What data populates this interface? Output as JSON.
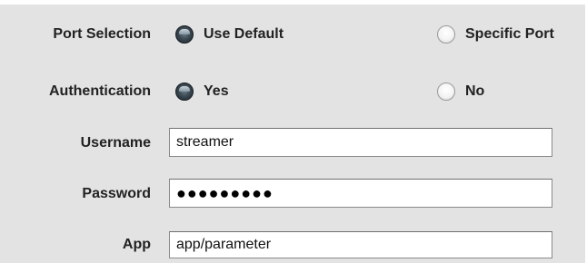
{
  "port_selection": {
    "label": "Port Selection",
    "options": [
      {
        "label": "Use Default",
        "selected": true
      },
      {
        "label": "Specific Port",
        "selected": false
      }
    ]
  },
  "authentication": {
    "label": "Authentication",
    "options": [
      {
        "label": "Yes",
        "selected": true
      },
      {
        "label": "No",
        "selected": false
      }
    ]
  },
  "username": {
    "label": "Username",
    "value": "streamer"
  },
  "password": {
    "label": "Password",
    "value": "●●●●●●●●●"
  },
  "app": {
    "label": "App",
    "value": "app/parameter"
  }
}
